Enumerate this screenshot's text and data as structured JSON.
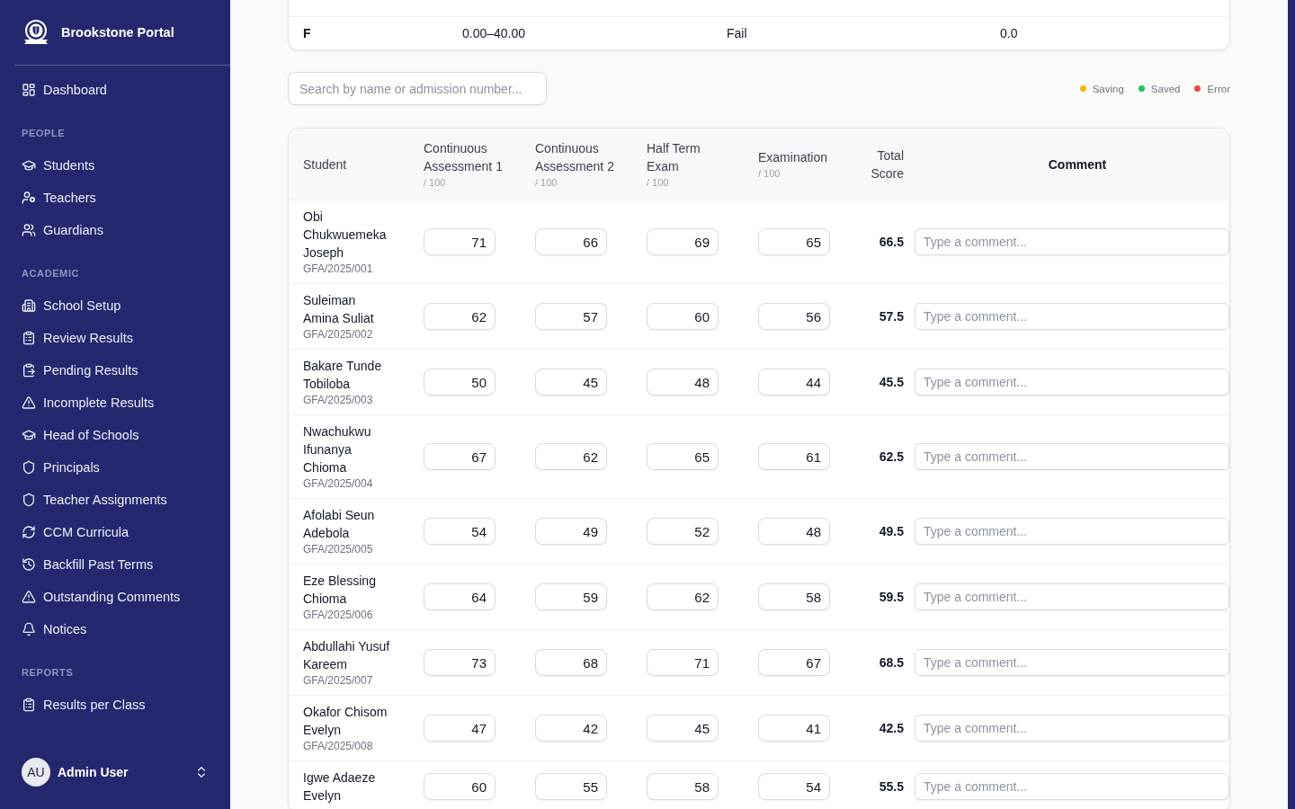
{
  "sidebar": {
    "brand": "Brookstone Portal",
    "sections": [
      {
        "items": [
          {
            "label": "Dashboard"
          }
        ]
      },
      {
        "heading": "PEOPLE",
        "items": [
          {
            "label": "Students"
          },
          {
            "label": "Teachers"
          },
          {
            "label": "Guardians"
          }
        ]
      },
      {
        "heading": "ACADEMIC",
        "items": [
          {
            "label": "School Setup"
          },
          {
            "label": "Review Results"
          },
          {
            "label": "Pending Results"
          },
          {
            "label": "Incomplete Results"
          },
          {
            "label": "Head of Schools"
          },
          {
            "label": "Principals"
          },
          {
            "label": "Teacher Assignments"
          },
          {
            "label": "CCM Curricula"
          },
          {
            "label": "Backfill Past Terms"
          },
          {
            "label": "Outstanding Comments"
          },
          {
            "label": "Notices"
          }
        ]
      },
      {
        "heading": "REPORTS",
        "items": [
          {
            "label": "Results per Class"
          }
        ]
      }
    ],
    "user": {
      "initials": "AU",
      "name": "Admin User"
    }
  },
  "grade_scale": {
    "rows": [
      {
        "cells": [
          "F",
          "0.00–40.00",
          "Fail",
          "0.0"
        ]
      }
    ]
  },
  "search": {
    "placeholder": "Search by name or admission number..."
  },
  "legend": {
    "items": [
      {
        "label": "Saving",
        "color": "#f5b70b"
      },
      {
        "label": "Saved",
        "color": "#22c55e"
      },
      {
        "label": "Error",
        "color": "#ef4444"
      }
    ]
  },
  "scores_table": {
    "columns": [
      {
        "kind": "student",
        "label": "Student"
      },
      {
        "kind": "score",
        "label": "Continuous Assessment 1",
        "max": "/ 100"
      },
      {
        "kind": "score",
        "label": "Continuous Assessment 2",
        "max": "/ 100"
      },
      {
        "kind": "score",
        "label": "Half Term Exam",
        "max": "/ 100"
      },
      {
        "kind": "score",
        "label": "Examination",
        "max": "/ 100"
      },
      {
        "kind": "total",
        "label": "Total Score"
      },
      {
        "kind": "comment",
        "label": "Comment"
      }
    ],
    "rows": [
      {
        "name": "Obi Chukwuemeka Joseph",
        "admission_number": "GFA/2025/001",
        "scores": [
          "71",
          "66",
          "69",
          "65"
        ],
        "total": "66.5",
        "comment": {
          "placeholder": "Type a comment..."
        }
      },
      {
        "name": "Suleiman Amina Suliat",
        "admission_number": "GFA/2025/002",
        "scores": [
          "62",
          "57",
          "60",
          "56"
        ],
        "total": "57.5",
        "comment": {
          "placeholder": "Type a comment..."
        }
      },
      {
        "name": "Bakare Tunde Tobiloba",
        "admission_number": "GFA/2025/003",
        "scores": [
          "50",
          "45",
          "48",
          "44"
        ],
        "total": "45.5",
        "comment": {
          "placeholder": "Type a comment..."
        }
      },
      {
        "name": "Nwachukwu Ifunanya Chioma",
        "admission_number": "GFA/2025/004",
        "scores": [
          "67",
          "62",
          "65",
          "61"
        ],
        "total": "62.5",
        "comment": {
          "placeholder": "Type a comment..."
        }
      },
      {
        "name": "Afolabi Seun Adebola",
        "admission_number": "GFA/2025/005",
        "scores": [
          "54",
          "49",
          "52",
          "48"
        ],
        "total": "49.5",
        "comment": {
          "placeholder": "Type a comment..."
        }
      },
      {
        "name": "Eze Blessing Chioma",
        "admission_number": "GFA/2025/006",
        "scores": [
          "64",
          "59",
          "62",
          "58"
        ],
        "total": "59.5",
        "comment": {
          "placeholder": "Type a comment..."
        }
      },
      {
        "name": "Abdullahi Yusuf Kareem",
        "admission_number": "GFA/2025/007",
        "scores": [
          "73",
          "68",
          "71",
          "67"
        ],
        "total": "68.5",
        "comment": {
          "placeholder": "Type a comment..."
        }
      },
      {
        "name": "Okafor Chisom Evelyn",
        "admission_number": "GFA/2025/008",
        "scores": [
          "47",
          "42",
          "45",
          "41"
        ],
        "total": "42.5",
        "comment": {
          "placeholder": "Type a comment..."
        }
      },
      {
        "name": "Igwe Adaeze Evelyn",
        "scores": [
          "60",
          "55",
          "58",
          "54"
        ],
        "total": "55.5",
        "comment": {
          "placeholder": "Type a comment..."
        }
      }
    ]
  }
}
